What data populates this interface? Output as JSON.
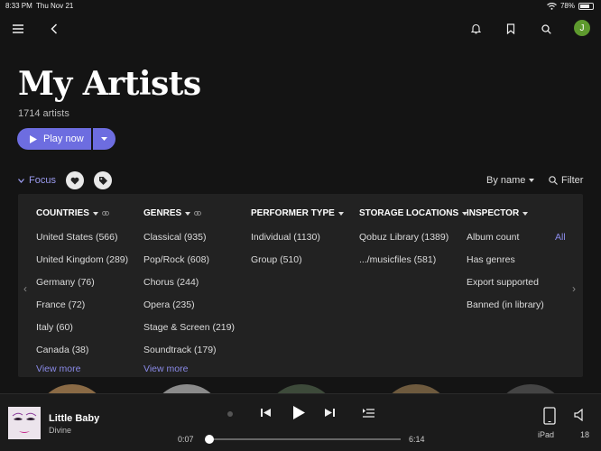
{
  "status": {
    "time": "8:33 PM",
    "date": "Thu Nov 21",
    "battery": "78%",
    "battery_level": 0.78
  },
  "nav": {
    "avatar_initial": "J",
    "accent": "#5e9a2e"
  },
  "page": {
    "title": "My Artists",
    "subtitle": "1714 artists",
    "play_label": "Play now",
    "accent": "#6d6de0"
  },
  "toolbar": {
    "focus_label": "Focus",
    "sort_label": "By name",
    "filter_label": "Filter"
  },
  "filters": {
    "countries": {
      "header": "COUNTRIES",
      "items": [
        "United States (566)",
        "United Kingdom (289)",
        "Germany (76)",
        "France (72)",
        "Italy (60)",
        "Canada (38)"
      ],
      "view_more": "View more"
    },
    "genres": {
      "header": "GENRES",
      "items": [
        "Classical (935)",
        "Pop/Rock (608)",
        "Chorus (244)",
        "Opera (235)",
        "Stage & Screen (219)",
        "Soundtrack (179)"
      ],
      "view_more": "View more"
    },
    "performer_type": {
      "header": "PERFORMER TYPE",
      "items": [
        "Individual (1130)",
        "Group (510)"
      ]
    },
    "storage": {
      "header": "STORAGE LOCATIONS",
      "items": [
        "Qobuz Library (1389)",
        ".../musicfiles (581)"
      ]
    },
    "inspector": {
      "header": "INSPECTOR",
      "items": [
        "Album count",
        "Has genres",
        "Export supported",
        "Banned (in library)"
      ],
      "all_label": "All"
    }
  },
  "player": {
    "track": "Little Baby",
    "artist": "Divine",
    "elapsed": "0:07",
    "duration": "6:14",
    "progress": 0.02,
    "device": "iPad",
    "volume": "18"
  }
}
